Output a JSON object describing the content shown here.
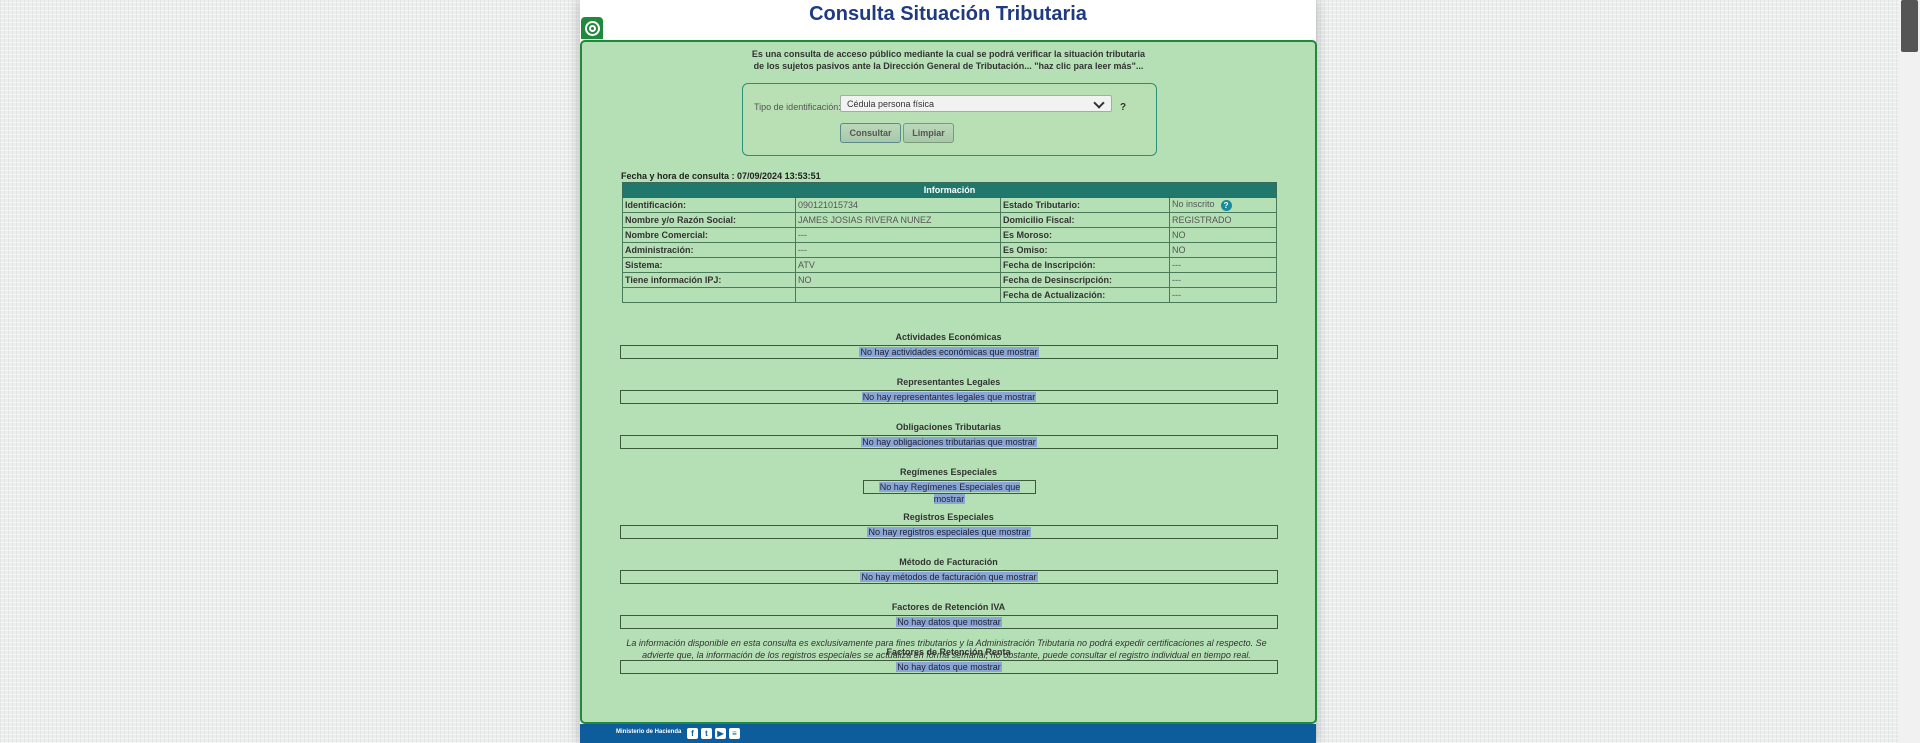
{
  "page": {
    "title": "Consulta Situación Tributaria",
    "intro_line1": "Es una consulta de acceso público mediante la cual se podrá verificar la situación tributaria",
    "intro_line2": "de los sujetos pasivos ante la Dirección General de Tributación... \"haz clic para leer más\"...",
    "accent_color": "#1f8a3c",
    "panel_color": "#b5dfb4"
  },
  "search": {
    "id_type_label": "Tipo de identificación:",
    "id_type_value": "Cédula persona física",
    "help": "?",
    "consult_label": "Consultar",
    "clear_label": "Limpiar"
  },
  "query_date": "Fecha y hora de consulta : 07/09/2024 13:53:51",
  "info": {
    "header": "Información",
    "rows": [
      {
        "l1": "Identificación:",
        "v1": "090121015734",
        "l2": "Estado Tributario:",
        "v2": "No inscrito"
      },
      {
        "l1": "Nombre y/o Razón Social:",
        "v1": "JAMES JOSIAS RIVERA NUNEZ",
        "l2": "Domicilio Fiscal:",
        "v2": "REGISTRADO"
      },
      {
        "l1": "Nombre Comercial:",
        "v1": "---",
        "l2": "Es Moroso:",
        "v2": "NO"
      },
      {
        "l1": "Administración:",
        "v1": "---",
        "l2": "Es Omiso:",
        "v2": "NO"
      },
      {
        "l1": "Sistema:",
        "v1": "ATV",
        "l2": "Fecha de Inscripción:",
        "v2": "---"
      },
      {
        "l1": "Tiene información IPJ:",
        "v1": "NO",
        "l2": "Fecha de Desinscripción:",
        "v2": "---"
      },
      {
        "l1": "",
        "v1": "",
        "l2": "Fecha de Actualización:",
        "v2": "---"
      }
    ],
    "help_icon": "question-circle-icon",
    "help_glyph": "?"
  },
  "sections": [
    {
      "title": "Actividades Económicas",
      "message": "No hay actividades económicas que mostrar"
    },
    {
      "title": "Representantes Legales",
      "message": "No hay representantes legales que mostrar"
    },
    {
      "title": "Obligaciones Tributarias",
      "message": "No hay obligaciones tributarias que mostrar"
    },
    {
      "title": "Regímenes Especiales",
      "message": "No hay Regímenes Especiales que mostrar"
    },
    {
      "title": "Registros Especiales",
      "message": "No hay registros especiales que mostrar"
    },
    {
      "title": "Método de Facturación",
      "message": "No hay métodos de facturación que mostrar"
    },
    {
      "title": "Factores de Retención IVA",
      "message": "No hay datos que mostrar"
    },
    {
      "title": "Factores de Retención Renta",
      "message": "No hay datos que mostrar"
    }
  ],
  "disclaimer_line1": "La información disponible en esta consulta es exclusivamente para fines tributarios y la Administración Tributaria no podrá expedir certificaciones al respecto. Se",
  "disclaimer_line2": "advierte que, la información de los registros especiales se actualiza en forma semanal, no obstante, puede consultar el registro individual en tiempo real.",
  "footer": {
    "brand": "Ministerio de Hacienda",
    "icons": [
      "facebook-icon",
      "twitter-icon",
      "youtube-icon",
      "menu-list-icon"
    ],
    "glyphs": [
      "f",
      "t",
      "▶",
      "≡"
    ],
    "color": "#0d5c9b"
  }
}
